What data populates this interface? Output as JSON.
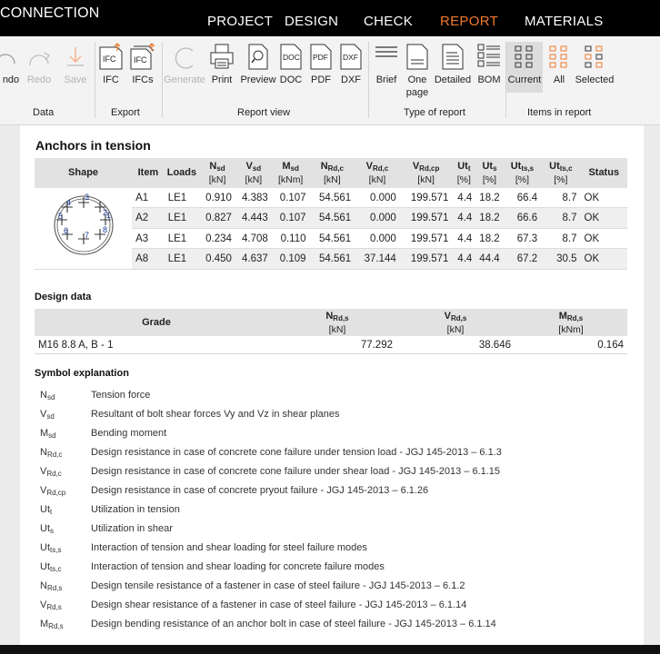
{
  "app": {
    "title": "CONNECTION"
  },
  "menu": [
    "PROJECT",
    "DESIGN",
    "CHECK",
    "REPORT",
    "MATERIALS"
  ],
  "ribbon": {
    "undo": "ndo",
    "redo": "Redo",
    "save": "Save",
    "ifc": "IFC",
    "ifcs": "IFCs",
    "generate": "Generate",
    "print": "Print",
    "preview": "Preview",
    "doc": "DOC",
    "pdf": "PDF",
    "dxf": "DXF",
    "brief": "Brief",
    "onepage": "One page",
    "detailed": "Detailed",
    "bom": "BOM",
    "current": "Current",
    "all": "All",
    "selected": "Selected",
    "ifc_icon": "IFC",
    "ifcs_icon": "IFC",
    "doc_icon": "DOC",
    "pdf_icon": "PDF",
    "dxf_icon": "DXF"
  },
  "groups": {
    "data": "Data",
    "export": "Export",
    "reportview": "Report view",
    "type": "Type of report",
    "items": "Items in report"
  },
  "anchors": {
    "title": "Anchors in tension",
    "headers": {
      "shape": "Shape",
      "item": "Item",
      "loads": "Loads",
      "nsd": {
        "main": "N",
        "sub": "sd",
        "unit": "[kN]"
      },
      "vsd": {
        "main": "V",
        "sub": "sd",
        "unit": "[kN]"
      },
      "msd": {
        "main": "M",
        "sub": "sd",
        "unit": "[kNm]"
      },
      "nrdc": {
        "main": "N",
        "sub": "Rd,c",
        "unit": "[kN]"
      },
      "vrdc": {
        "main": "V",
        "sub": "Rd,c",
        "unit": "[kN]"
      },
      "vrdcp": {
        "main": "V",
        "sub": "Rd,cp",
        "unit": "[kN]"
      },
      "utt": {
        "main": "Ut",
        "sub": "t",
        "unit": "[%]"
      },
      "uts": {
        "main": "Ut",
        "sub": "s",
        "unit": "[%]"
      },
      "utts": {
        "main": "Ut",
        "sub": "ts,s",
        "unit": "[%]"
      },
      "uttc": {
        "main": "Ut",
        "sub": "ts,c",
        "unit": "[%]"
      },
      "status": "Status"
    },
    "shape_labels": [
      "1",
      "2",
      "3",
      "4",
      "5",
      "6",
      "7",
      "8"
    ],
    "rows": [
      {
        "item": "A1",
        "loads": "LE1",
        "nsd": "0.910",
        "vsd": "4.383",
        "msd": "0.107",
        "nrdc": "54.561",
        "vrdc": "0.000",
        "vrdcp": "199.571",
        "utt": "4.4",
        "uts": "18.2",
        "utts": "66.4",
        "uttc": "8.7",
        "status": "OK"
      },
      {
        "item": "A2",
        "loads": "LE1",
        "nsd": "0.827",
        "vsd": "4.443",
        "msd": "0.107",
        "nrdc": "54.561",
        "vrdc": "0.000",
        "vrdcp": "199.571",
        "utt": "4.4",
        "uts": "18.2",
        "utts": "66.6",
        "uttc": "8.7",
        "status": "OK"
      },
      {
        "item": "A3",
        "loads": "LE1",
        "nsd": "0.234",
        "vsd": "4.708",
        "msd": "0.110",
        "nrdc": "54.561",
        "vrdc": "0.000",
        "vrdcp": "199.571",
        "utt": "4.4",
        "uts": "18.2",
        "utts": "67.3",
        "uttc": "8.7",
        "status": "OK"
      },
      {
        "item": "A8",
        "loads": "LE1",
        "nsd": "0.450",
        "vsd": "4.637",
        "msd": "0.109",
        "nrdc": "54.561",
        "vrdc": "37.144",
        "vrdcp": "199.571",
        "utt": "4.4",
        "uts": "44.4",
        "utts": "67.2",
        "uttc": "30.5",
        "status": "OK"
      }
    ]
  },
  "design": {
    "title": "Design data",
    "headers": {
      "grade": "Grade",
      "nrds": {
        "main": "N",
        "sub": "Rd,s",
        "unit": "[kN]"
      },
      "vrds": {
        "main": "V",
        "sub": "Rd,s",
        "unit": "[kN]"
      },
      "mrds": {
        "main": "M",
        "sub": "Rd,s",
        "unit": "[kNm]"
      }
    },
    "row": {
      "grade": "M16 8.8 A, B - 1",
      "nrds": "77.292",
      "vrds": "38.646",
      "mrds": "0.164"
    }
  },
  "symbols": {
    "title": "Symbol explanation",
    "items": [
      {
        "main": "N",
        "sub": "sd",
        "desc": "Tension force"
      },
      {
        "main": "V",
        "sub": "sd",
        "desc": "Resultant of bolt shear forces Vy and Vz in shear planes"
      },
      {
        "main": "M",
        "sub": "sd",
        "desc": "Bending moment"
      },
      {
        "main": "N",
        "sub": "Rd,c",
        "desc": "Design resistance in case of concrete cone failure under tension load - JGJ 145-2013 – 6.1.3"
      },
      {
        "main": "V",
        "sub": "Rd,c",
        "desc": "Design resistance in case of concrete cone failure under shear load - JGJ 145-2013 – 6.1.15"
      },
      {
        "main": "V",
        "sub": "Rd,cp",
        "desc": "Design resistance in case of concrete pryout failure - JGJ 145-2013 – 6.1.26"
      },
      {
        "main": "Ut",
        "sub": "t",
        "desc": "Utilization in tension"
      },
      {
        "main": "Ut",
        "sub": "s",
        "desc": "Utilization in shear"
      },
      {
        "main": "Ut",
        "sub": "ts,s",
        "desc": "Interaction of tension and shear loading for steel failure modes"
      },
      {
        "main": "Ut",
        "sub": "ts,c",
        "desc": "Interaction of tension and shear loading for concrete failure modes"
      },
      {
        "main": "N",
        "sub": "Rd,s",
        "desc": "Design tensile resistance of a fastener in case of steel failure - JGJ 145-2013 – 6.1.2"
      },
      {
        "main": "V",
        "sub": "Rd,s",
        "desc": "Design shear resistance of a fastener in case of steel failure - JGJ 145-2013 – 6.1.14"
      },
      {
        "main": "M",
        "sub": "Rd,s",
        "desc": "Design bending resistance of an anchor bolt in case of steel failure - JGJ 145-2013 – 6.1.14"
      }
    ]
  },
  "colors": {
    "accent": "#f07a2e",
    "topbar": "#000000",
    "header_bg": "#e2e2e2"
  }
}
